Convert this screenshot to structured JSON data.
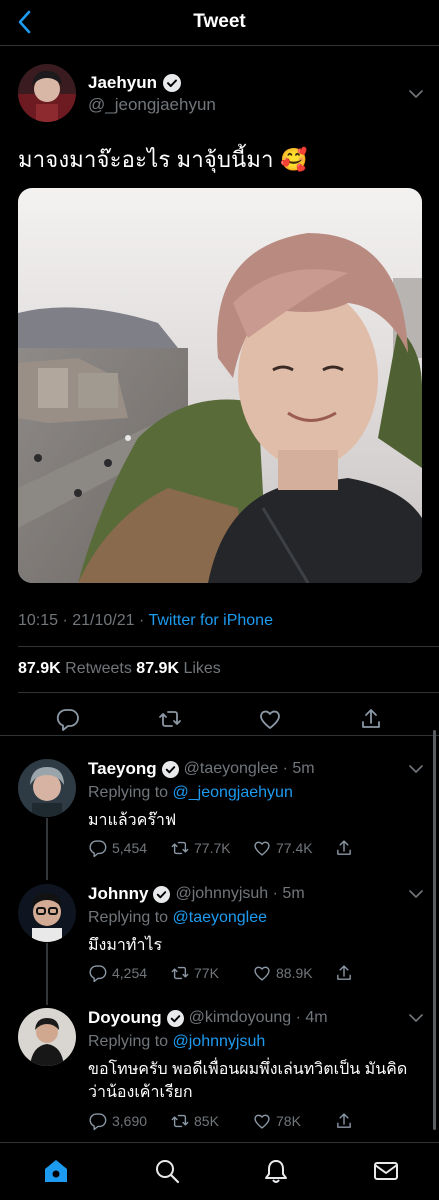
{
  "header": {
    "title": "Tweet"
  },
  "tweet": {
    "author_name": "Jaehyun",
    "author_handle": "@_jeongjaehyun",
    "text": "มาจงมาจ๊ะอะไร มาจุ้บนี้มา 🥰",
    "time": "10:15 · 21/10/21 · ",
    "source": "Twitter for iPhone",
    "retweets_count": "87.9K",
    "retweets_label": " Retweets  ",
    "likes_count": "87.9K",
    "likes_label": " Likes"
  },
  "replies": [
    {
      "name": "Taeyong",
      "handle": "@taeyonglee · 5m",
      "replying_prefix": "Replying to ",
      "replying_to": "@_jeongjaehyun",
      "text": "มาแล้วคร๊าฟ",
      "reply_count": "5,454",
      "retweet_count": "77.7K",
      "like_count": "77.4K"
    },
    {
      "name": "Johnny",
      "handle": "@johnnyjsuh · 5m",
      "replying_prefix": "Replying to ",
      "replying_to": "@taeyonglee",
      "text": "มึงมาทำไร",
      "reply_count": "4,254",
      "retweet_count": "77K",
      "like_count": "88.9K"
    },
    {
      "name": "Doyoung",
      "handle": "@kimdoyoung · 4m",
      "replying_prefix": "Replying to ",
      "replying_to": "@johnnyjsuh",
      "text": "ขอโทษครับ พอดีเพื่อนผมพึ่งเล่นทวิตเป็น มันคิดว่าน้องเค้าเรียก",
      "reply_count": "3,690",
      "retweet_count": "85K",
      "like_count": "78K"
    }
  ],
  "colors": {
    "accent": "#1d9bf0",
    "background": "#000000",
    "muted": "#71767b",
    "verified": "#1d9bf0"
  },
  "icons": [
    "back-chevron-icon",
    "verified-badge-icon",
    "caret-down-icon",
    "reply-icon",
    "retweet-icon",
    "like-icon",
    "share-icon",
    "home-icon",
    "search-icon",
    "notifications-icon",
    "messages-icon"
  ]
}
